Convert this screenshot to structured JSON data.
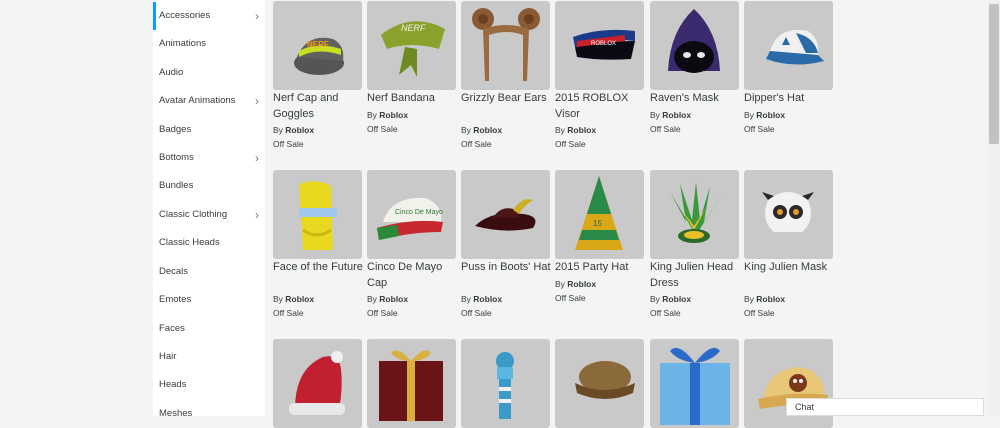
{
  "categories": [
    {
      "label": "Accessories",
      "chevron": true,
      "active": true
    },
    {
      "label": "Animations",
      "chevron": false
    },
    {
      "label": "Audio",
      "chevron": false
    },
    {
      "label": "Avatar Animations",
      "chevron": true
    },
    {
      "label": "Badges",
      "chevron": false
    },
    {
      "label": "Bottoms",
      "chevron": true
    },
    {
      "label": "Bundles",
      "chevron": false
    },
    {
      "label": "Classic Clothing",
      "chevron": true
    },
    {
      "label": "Classic Heads",
      "chevron": false
    },
    {
      "label": "Decals",
      "chevron": false
    },
    {
      "label": "Emotes",
      "chevron": false
    },
    {
      "label": "Faces",
      "chevron": false
    },
    {
      "label": "Hair",
      "chevron": false
    },
    {
      "label": "Heads",
      "chevron": false
    },
    {
      "label": "Meshes",
      "chevron": false
    }
  ],
  "chevron_glyph": "›",
  "items": [
    {
      "name": "Nerf Cap and Goggles",
      "by": "By",
      "creator": "Roblox",
      "price": "Off Sale",
      "icon": "nerf-cap-thumbnail"
    },
    {
      "name": "Nerf Bandana",
      "by": "By",
      "creator": "Roblox",
      "price": "Off Sale",
      "icon": "nerf-bandana-thumbnail"
    },
    {
      "name": "Grizzly Bear Ears",
      "by": "By",
      "creator": "Roblox",
      "price": "Off Sale",
      "icon": "bear-ears-thumbnail"
    },
    {
      "name": "2015 ROBLOX Visor",
      "by": "By",
      "creator": "Roblox",
      "price": "Off Sale",
      "icon": "visor-thumbnail"
    },
    {
      "name": "Raven's Mask",
      "by": "By",
      "creator": "Roblox",
      "price": "Off Sale",
      "icon": "raven-mask-thumbnail"
    },
    {
      "name": "Dipper's Hat",
      "by": "By",
      "creator": "Roblox",
      "price": "Off Sale",
      "icon": "dipper-hat-thumbnail"
    },
    {
      "name": "Face of the Future",
      "by": "By",
      "creator": "Roblox",
      "price": "Off Sale",
      "icon": "face-future-thumbnail"
    },
    {
      "name": "Cinco De Mayo Cap",
      "by": "By",
      "creator": "Roblox",
      "price": "Off Sale",
      "icon": "cinco-cap-thumbnail"
    },
    {
      "name": "Puss in Boots' Hat",
      "by": "By",
      "creator": "Roblox",
      "price": "Off Sale",
      "icon": "puss-hat-thumbnail"
    },
    {
      "name": "2015 Party Hat",
      "by": "By",
      "creator": "Roblox",
      "price": "Off Sale",
      "icon": "party-hat-thumbnail"
    },
    {
      "name": "King Julien Head Dress",
      "by": "By",
      "creator": "Roblox",
      "price": "Off Sale",
      "icon": "julien-headdress-thumbnail"
    },
    {
      "name": "King Julien Mask",
      "by": "By",
      "creator": "Roblox",
      "price": "Off Sale",
      "icon": "julien-mask-thumbnail"
    },
    {
      "icon": "santa-hat-thumbnail"
    },
    {
      "icon": "gift-box-thumbnail"
    },
    {
      "icon": "winter-scarf-thumbnail"
    },
    {
      "icon": "brown-cap-thumbnail"
    },
    {
      "icon": "blue-gift-thumbnail"
    },
    {
      "icon": "owl-cap-thumbnail"
    }
  ],
  "chat": {
    "label": "Chat"
  }
}
